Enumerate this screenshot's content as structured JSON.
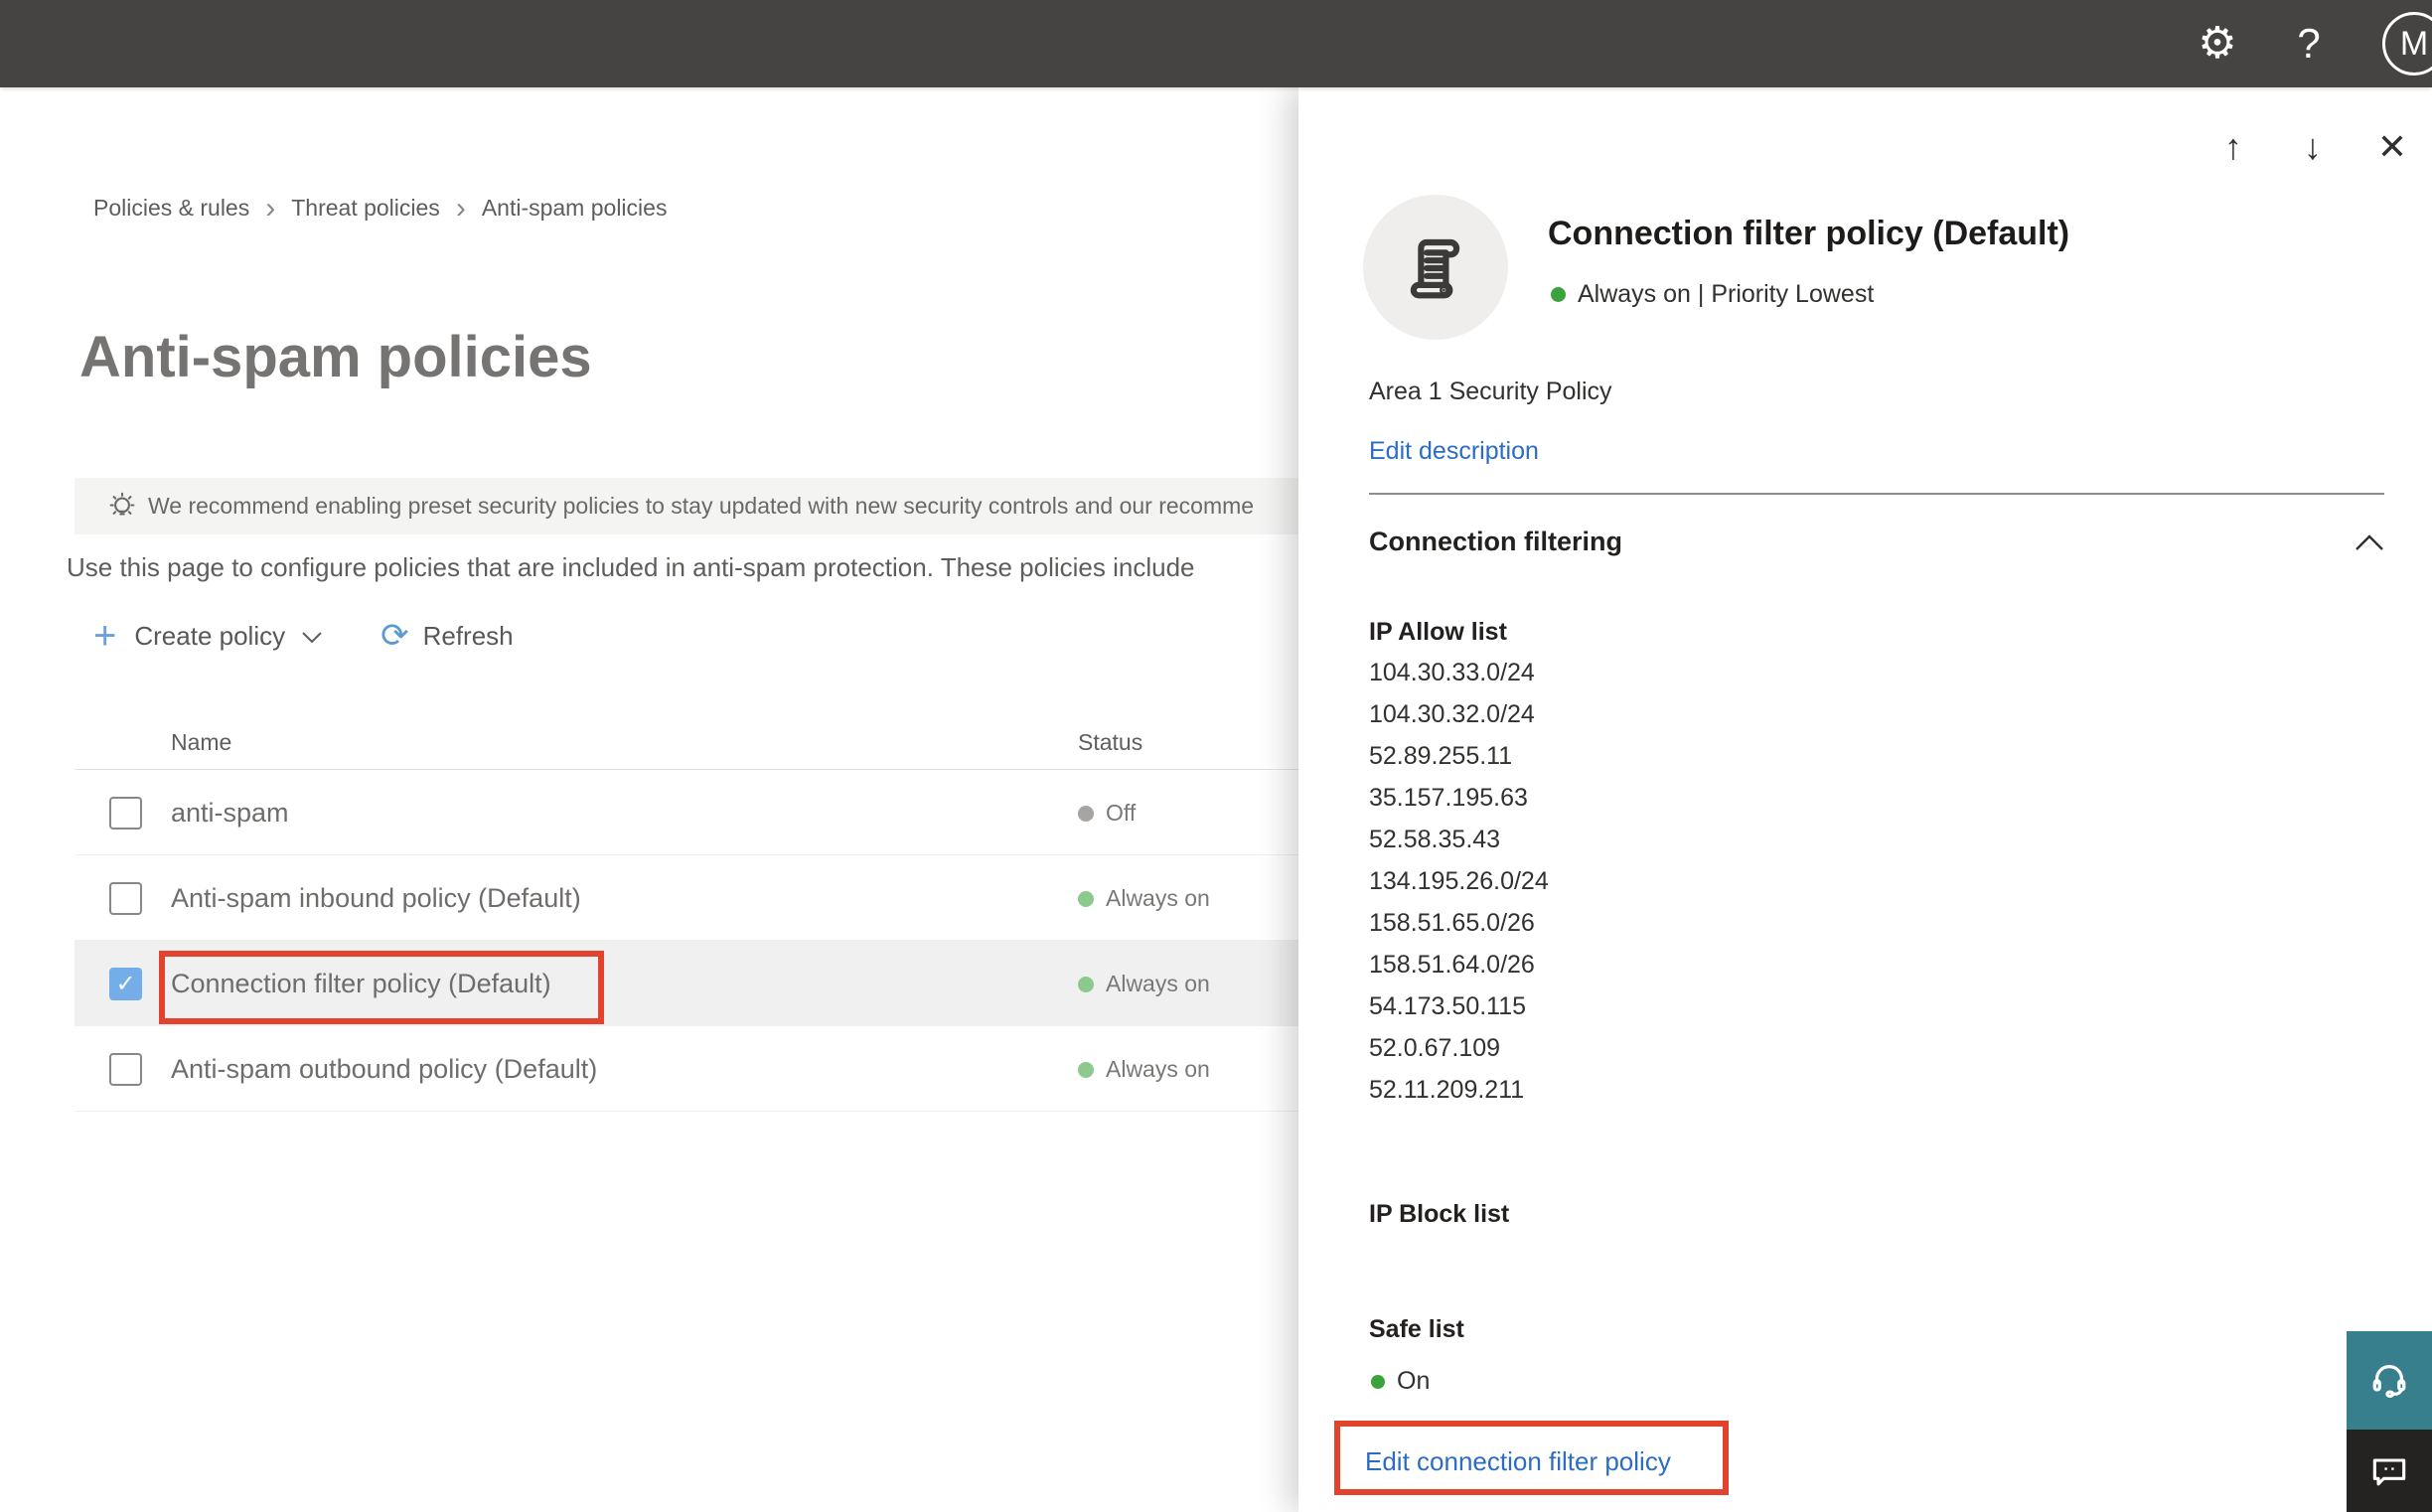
{
  "topbar": {
    "settings_glyph": "⚙",
    "help_glyph": "?",
    "avatar_initial": "M"
  },
  "breadcrumb": {
    "separator": "›",
    "items": [
      "Policies & rules",
      "Threat policies",
      "Anti-spam policies"
    ]
  },
  "page": {
    "title": "Anti-spam policies",
    "banner_text": "We recommend enabling preset security policies to stay updated with new security controls and our recomme",
    "description": "Use this page to configure policies that are included in anti-spam protection. These policies include",
    "toolbar": {
      "plus_glyph": "+",
      "create_policy_label": "Create policy",
      "refresh_glyph": "⟳",
      "refresh_label": "Refresh"
    }
  },
  "table": {
    "columns": {
      "name": "Name",
      "status": "Status"
    },
    "check_glyph": "✓",
    "rows": [
      {
        "name": "anti-spam",
        "status": "Off",
        "status_color": "#a7a5a3",
        "checked": false,
        "selected": false
      },
      {
        "name": "Anti-spam inbound policy (Default)",
        "status": "Always on",
        "status_color": "#8cc98c",
        "checked": false,
        "selected": false
      },
      {
        "name": "Connection filter policy (Default)",
        "status": "Always on",
        "status_color": "#8cc98c",
        "checked": true,
        "selected": true,
        "annotated": true
      },
      {
        "name": "Anti-spam outbound policy (Default)",
        "status": "Always on",
        "status_color": "#8cc98c",
        "checked": false,
        "selected": false
      }
    ]
  },
  "panel": {
    "nav_up_glyph": "↑",
    "nav_down_glyph": "↓",
    "close_glyph": "✕",
    "title": "Connection filter policy (Default)",
    "status_line": "Always on | Priority Lowest",
    "status_dot_color": "#3aa33c",
    "description": "Area 1 Security Policy",
    "edit_description_label": "Edit description",
    "section_title": "Connection filtering",
    "ip_allow_title": "IP Allow list",
    "ip_allow_list": [
      "104.30.33.0/24",
      "104.30.32.0/24",
      "52.89.255.11",
      "35.157.195.63",
      "52.58.35.43",
      "134.195.26.0/24",
      "158.51.65.0/26",
      "158.51.64.0/26",
      "54.173.50.115",
      "52.0.67.109",
      "52.11.209.211"
    ],
    "ip_block_title": "IP Block list",
    "safe_list_title": "Safe list",
    "safe_list_value": "On",
    "safe_list_dot_color": "#3aa33c",
    "edit_link_label": "Edit connection filter policy"
  },
  "colors": {
    "annotation_red": "#e2432c",
    "link_blue": "#2b6cc4",
    "topbar": "#454443",
    "teal_button": "#377f8d",
    "dark_button": "#242322"
  },
  "icons_used": [
    "gear-icon",
    "help-icon",
    "avatar",
    "lightbulb-icon",
    "plus-icon",
    "chevron-down-icon",
    "refresh-icon",
    "checkbox",
    "arrow-up-icon",
    "arrow-down-icon",
    "close-icon",
    "scroll-icon",
    "chevron-up-icon",
    "headset-icon",
    "chat-icon",
    "status-dot"
  ]
}
